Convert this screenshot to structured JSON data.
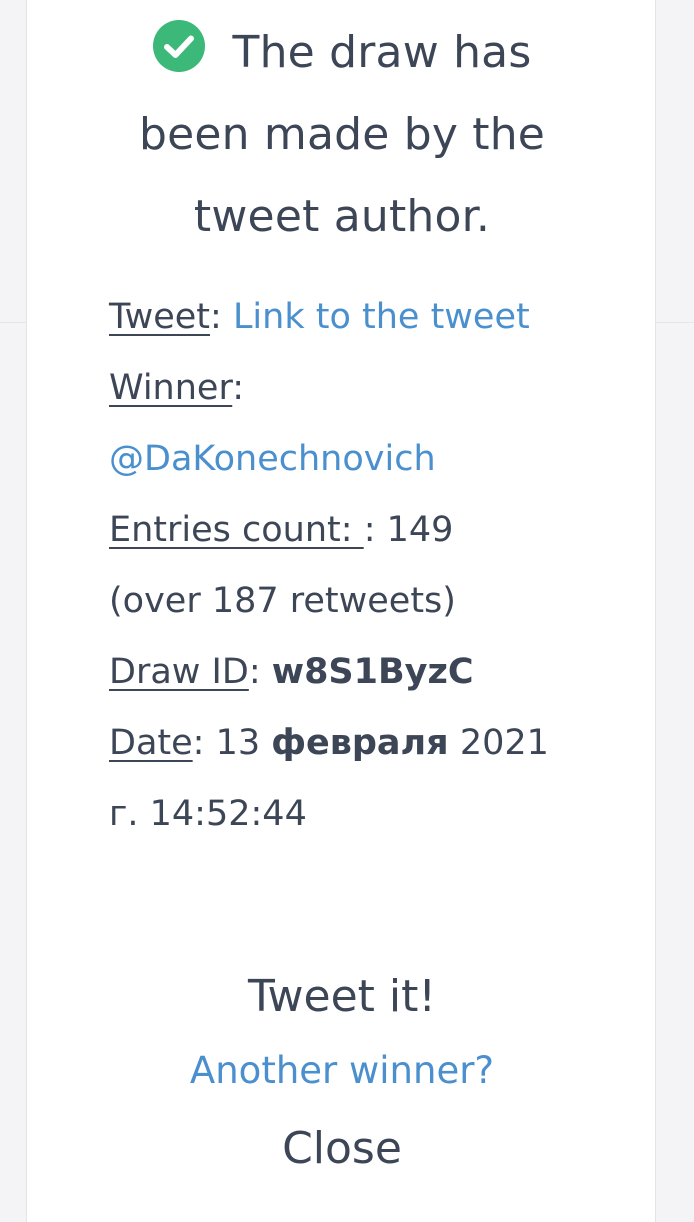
{
  "header": {
    "status_text": "The draw has been made by the tweet author."
  },
  "details": {
    "tweet_label": "Tweet",
    "tweet_link": "Link to the tweet",
    "winner_label": "Winner",
    "winner_handle": "@DaKonechnovich",
    "entries_label": "Entries count: ",
    "entries_value": "149 (over 187 retweets)",
    "draw_id_label": "Draw ID",
    "draw_id_value": "w8S1ByzC",
    "date_label": "Date",
    "date_day": "13",
    "date_month": "февраля",
    "date_rest": "2021 г. 14:52:44"
  },
  "actions": {
    "tweet_it": "Tweet it!",
    "another_winner": "Another winner?",
    "close": "Close"
  },
  "colors": {
    "success": "#3cb878",
    "link": "#4a8fce",
    "text": "#3c4656"
  },
  "icons": {
    "status": "check-circle-icon"
  }
}
